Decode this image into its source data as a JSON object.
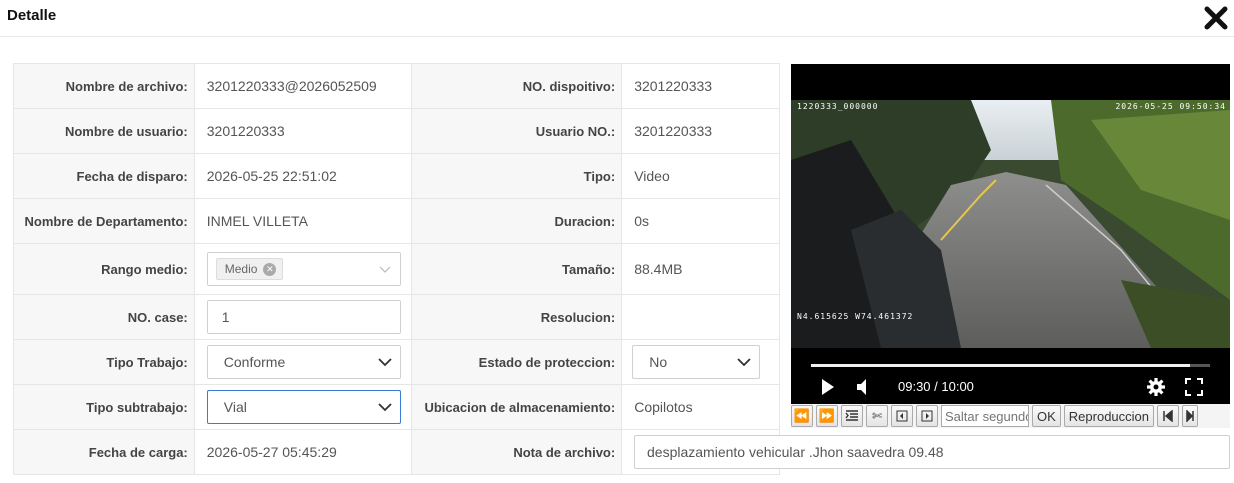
{
  "dialog": {
    "title": "Detalle"
  },
  "labels": {
    "file_name": "Nombre de archivo:",
    "device_no": "NO. dispoitivo:",
    "user_name": "Nombre de usuario:",
    "user_no": "Usuario NO.:",
    "trigger_date": "Fecha de disparo:",
    "type": "Tipo:",
    "department": "Nombre de Departamento:",
    "duration": "Duracion:",
    "media_range": "Rango medio:",
    "size": "Tamaño:",
    "case_no": "NO. case:",
    "resolution": "Resolucion:",
    "work_type": "Tipo Trabajo:",
    "protection": "Estado de proteccion:",
    "work_subtype": "Tipo subtrabajo:",
    "storage": "Ubicacion de almacenamiento:",
    "upload_date": "Fecha de carga:",
    "file_note": "Nota de archivo:"
  },
  "values": {
    "file_name": "3201220333@2026052509",
    "device_no": "3201220333",
    "user_name": "3201220333",
    "user_no": "3201220333",
    "trigger_date": "2026-05-25 22:51:02",
    "type": "Video",
    "department": "INMEL VILLETA",
    "duration": "0s",
    "media_range_tag": "Medio",
    "size": "88.4MB",
    "case_no": "1",
    "resolution": "",
    "work_type": "Conforme",
    "protection": "No",
    "work_subtype": "Vial",
    "storage": "Copilotos",
    "upload_date": "2026-05-27 05:45:29",
    "file_note": "desplazamiento vehicular .Jhon saavedra 09.48"
  },
  "video": {
    "osd_device": "1220333_000000",
    "osd_datetime": "2026-05-25 09:50:34",
    "osd_gps": "N4.615625 W74.461372",
    "time": "09:30 / 10:00",
    "progress": 0.95
  },
  "toolbar": {
    "skip_placeholder": "Saltar segundo",
    "ok_label": "OK",
    "playback_label": "Reproduccion"
  }
}
